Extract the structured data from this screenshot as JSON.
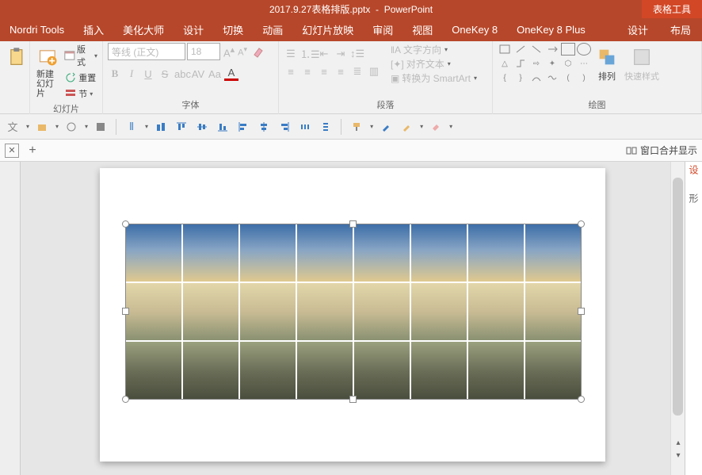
{
  "title": {
    "filename": "2017.9.27表格排版.pptx",
    "app": "PowerPoint",
    "contextual": "表格工具"
  },
  "tabs": {
    "items": [
      "Nordri Tools",
      "插入",
      "美化大师",
      "设计",
      "切换",
      "动画",
      "幻灯片放映",
      "审阅",
      "视图",
      "OneKey 8",
      "OneKey 8 Plus"
    ],
    "ctx": [
      "设计",
      "布局"
    ]
  },
  "groups": {
    "slides": {
      "label": "幻灯片",
      "new": "新建\n幻灯片",
      "layout": "版式",
      "reset": "重置",
      "section": "节"
    },
    "font": {
      "label": "字体",
      "name": "等线 (正文)",
      "size": "18"
    },
    "paragraph": {
      "label": "段落",
      "direction": "文字方向",
      "align": "对齐文本",
      "smartart": "转换为 SmartArt"
    },
    "drawing": {
      "label": "绘图",
      "arrange": "排列",
      "quickstyle": "快速样式"
    }
  },
  "subbar": {
    "merge": "窗口合并显示"
  },
  "panel": {
    "title": "设",
    "sub": "形"
  },
  "table": {
    "rows": 3,
    "cols": 8
  }
}
